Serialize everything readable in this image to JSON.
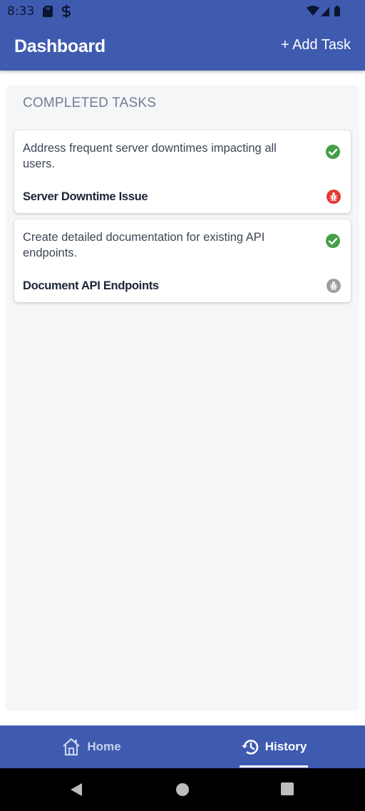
{
  "status_bar": {
    "time": "8:33"
  },
  "app_bar": {
    "title": "Dashboard",
    "add_task_label": "+ Add Task"
  },
  "section": {
    "title": "COMPLETED TASKS"
  },
  "tasks": [
    {
      "description": "Address frequent server downtimes impacting all users.",
      "title": "Server Downtime Issue",
      "status_icon": "check-circle-icon",
      "status_color": "#43a047",
      "priority_icon": "bug-icon",
      "priority_color": "#e53935"
    },
    {
      "description": "Create detailed documentation for existing API endpoints.",
      "title": "Document API Endpoints",
      "status_icon": "check-circle-icon",
      "status_color": "#43a047",
      "priority_icon": "bug-icon",
      "priority_color": "#9e9e9e"
    }
  ],
  "bottom_nav": {
    "home_label": "Home",
    "history_label": "History",
    "active": "History"
  },
  "colors": {
    "primary": "#3f5bb0",
    "background": "#f5f6f8"
  }
}
